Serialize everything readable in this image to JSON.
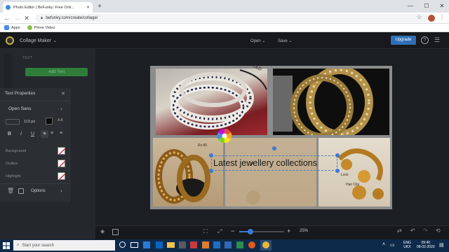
{
  "browser": {
    "tab_title": "Photo Editor | BeFunky: Free Onli...",
    "tab_close": "✕",
    "new_tab": "+",
    "window_controls": [
      "—",
      "☐",
      "✕"
    ],
    "url": "befunky.com/create/collage/",
    "bookmarks": [
      {
        "label": "Apps",
        "color": "#4a8af4"
      },
      {
        "label": "Prime Video",
        "color": "#8bc34a"
      }
    ]
  },
  "app": {
    "menu_title": "Collage Maker ⌄",
    "open_label": "Open ⌄",
    "save_label": "Save ⌄",
    "upgrade_label": "Upgrade",
    "help_label": "?",
    "left_panel": {
      "section_label": "TEXT",
      "add_text_label": "Add Text"
    },
    "text_properties": {
      "title": "Text Properties",
      "close_label": "✕",
      "font": "Open Sans",
      "font_chevron": "›",
      "size_value": "113 px",
      "spacing_label": "A A",
      "style_buttons": [
        "B",
        "I",
        "U"
      ],
      "rows": [
        "Background",
        "Outline",
        "Highlight"
      ],
      "options_label": "Options",
      "options_chevron": "›"
    },
    "canvas": {
      "text_box": "Latest jewellery collections",
      "photo_captions": [
        "Rs 80",
        "Hair Clip",
        "Lock"
      ]
    },
    "bottom_bar": {
      "zoom_minus": "−",
      "zoom_plus": "+",
      "zoom_level": "25%",
      "zoom_fraction": 0.25
    }
  },
  "taskbar": {
    "search_placeholder": "Start your search",
    "language": "ENG",
    "region": "UKX",
    "time": "09:40",
    "date": "08-02-2020"
  },
  "colors": {
    "accent": "#2f6fb7",
    "add_text_green": "#2f7d3a",
    "logo_gold": "#c9b04a",
    "taskbar": "#0e2a4b"
  }
}
